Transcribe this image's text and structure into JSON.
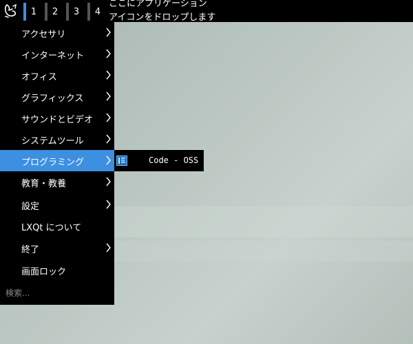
{
  "panel": {
    "workspaces": [
      "1",
      "2",
      "3",
      "4"
    ],
    "active_workspace": "1",
    "drop_hint_line1": "ここにアプリケーション",
    "drop_hint_line2": "アイコンをドロップします"
  },
  "menu": {
    "items": [
      {
        "label": "アクセサリ",
        "submenu": true
      },
      {
        "label": "インターネット",
        "submenu": true
      },
      {
        "label": "オフィス",
        "submenu": true
      },
      {
        "label": "グラフィックス",
        "submenu": true
      },
      {
        "label": "サウンドとビデオ",
        "submenu": true
      },
      {
        "label": "システムツール",
        "submenu": true
      },
      {
        "label": "プログラミング",
        "submenu": true,
        "selected": true
      },
      {
        "label": "教育・教養",
        "submenu": true
      },
      {
        "label": "設定",
        "submenu": true
      },
      {
        "label": "LXQt について",
        "submenu": false
      },
      {
        "label": "終了",
        "submenu": true
      },
      {
        "label": "画面ロック",
        "submenu": false
      }
    ],
    "search_placeholder": "検索..."
  },
  "submenu": {
    "items": [
      {
        "label": "Code - OSS",
        "icon": "vscode-icon"
      }
    ]
  },
  "colors": {
    "highlight": "#3d8fe0",
    "panel_bg": "#000000",
    "desktop_bg": "#b8c4bf"
  }
}
